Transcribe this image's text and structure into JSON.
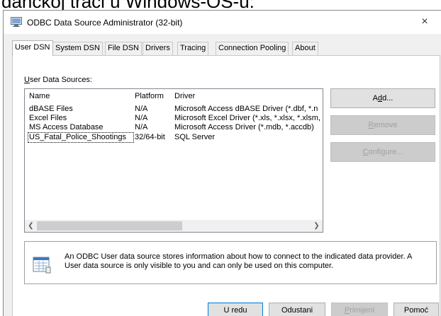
{
  "window": {
    "title": "ODBC Data Source Administrator (32-bit)",
    "close_glyph": "×",
    "icon": "odbc-admin-icon"
  },
  "tabs": [
    {
      "label": "User DSN",
      "active": true
    },
    {
      "label": "System DSN",
      "active": false
    },
    {
      "label": "File DSN",
      "active": false
    },
    {
      "label": "Drivers",
      "active": false
    },
    {
      "label": "Tracing",
      "active": false
    },
    {
      "label": "Connection Pooling",
      "active": false
    },
    {
      "label": "About",
      "active": false
    }
  ],
  "sources": {
    "label_underlined": "U",
    "label_rest": "ser Data Sources:",
    "columns": [
      "Name",
      "Platform",
      "Driver"
    ],
    "rows": [
      {
        "name": "dBASE Files",
        "platform": "N/A",
        "driver": "Microsoft Access dBASE Driver (*.dbf, *.n"
      },
      {
        "name": "Excel Files",
        "platform": "N/A",
        "driver": "Microsoft Excel Driver (*.xls, *.xlsx, *.xlsm,"
      },
      {
        "name": "MS Access Database",
        "platform": "N/A",
        "driver": "Microsoft Access Driver (*.mdb, *.accdb)"
      },
      {
        "name": "US_Fatal_Police_Shootings",
        "platform": "32/64-bit",
        "driver": "SQL Server",
        "focused": true
      }
    ]
  },
  "buttons": {
    "add": {
      "pre": "A",
      "u": "d",
      "post": "d..."
    },
    "remove": {
      "pre": "",
      "u": "R",
      "post": "emove",
      "disabled": true
    },
    "configure": {
      "pre": "",
      "u": "C",
      "post": "onfigure...",
      "disabled": true
    }
  },
  "info": {
    "line1": "An ODBC User data source stores information about how to connect to the indicated data provider.   A",
    "line2": "User data source is only visible to you and can only be used on this computer."
  },
  "footer": {
    "ok": "U redu",
    "cancel": "Odustani",
    "apply": {
      "u": "P",
      "post": "rimijeni",
      "disabled": true
    },
    "help": "Pomoć"
  },
  "background_caption": "danckoj traci u Windows-OS-u:",
  "colors": {
    "window_bg": "#f0f0f0",
    "disabled_text": "#a0a0a0",
    "default_border": "#0078d7"
  }
}
